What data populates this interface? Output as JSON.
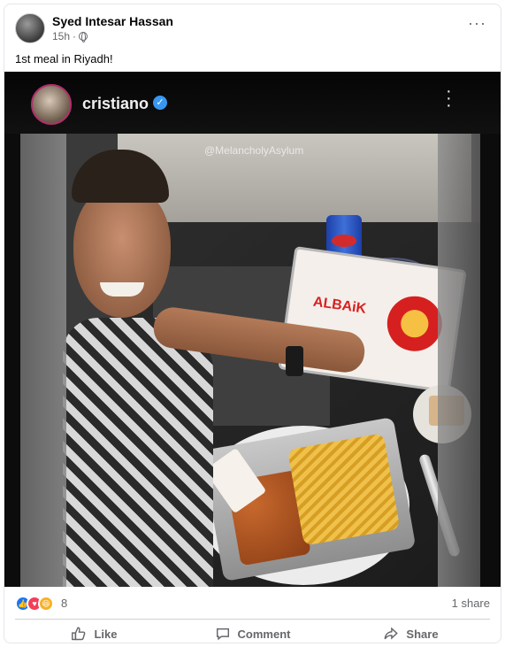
{
  "post": {
    "author": "Syed Intesar Hassan",
    "time": "15h",
    "caption": "1st meal in Riyadh!"
  },
  "photo": {
    "instagram_username": "cristiano",
    "watermark": "@MelancholyAsylum",
    "box_brand": "ALBAiK"
  },
  "engagement": {
    "reaction_count": "8",
    "share_count": "1 share"
  },
  "actions": {
    "like": "Like",
    "comment": "Comment",
    "share": "Share"
  },
  "icons": [
    "avatar",
    "globe-icon",
    "more-options-icon",
    "verified-badge-icon",
    "instagram-more-icon",
    "like-reaction-icon",
    "love-reaction-icon",
    "haha-reaction-icon",
    "like-icon",
    "comment-icon",
    "share-icon"
  ],
  "colors": {
    "facebook_blue": "#1877f2",
    "love_red": "#f33e58",
    "haha_yellow": "#f7b125",
    "secondary_text": "#65676b"
  }
}
